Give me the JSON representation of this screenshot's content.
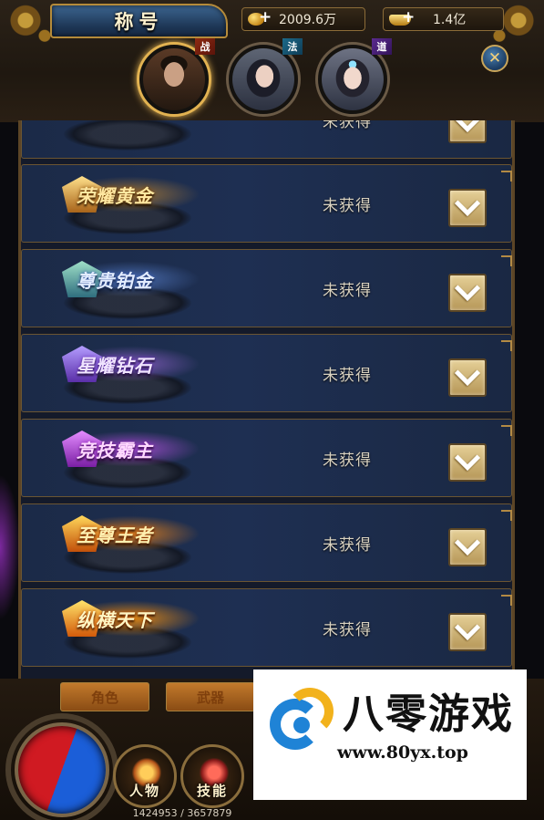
{
  "header": {
    "title": "称号",
    "gold": "2009.6万",
    "ingot": "1.4亿"
  },
  "classes": [
    {
      "badge": "战",
      "active": true
    },
    {
      "badge": "法",
      "active": false
    },
    {
      "badge": "道",
      "active": false
    }
  ],
  "titles": [
    {
      "name": "",
      "status": "未获得",
      "theme": "partial"
    },
    {
      "name": "荣耀黄金",
      "status": "未获得",
      "theme": "gold"
    },
    {
      "name": "尊贵铂金",
      "status": "未获得",
      "theme": "plat"
    },
    {
      "name": "星耀钻石",
      "status": "未获得",
      "theme": "dia"
    },
    {
      "name": "竞技霸主",
      "status": "未获得",
      "theme": "hegemon"
    },
    {
      "name": "至尊王者",
      "status": "未获得",
      "theme": "king"
    },
    {
      "name": "纵横天下",
      "status": "未获得",
      "theme": "world"
    }
  ],
  "bottom": {
    "sub_tabs": [
      "角色",
      "武器"
    ],
    "skills": [
      "人物",
      "技能"
    ],
    "exp_text": "1424953 / 3657879"
  },
  "watermark": {
    "brand": "八零游戏",
    "url": "www.80yx.top"
  },
  "icons": {
    "gold": "gold-coin-icon",
    "ingot": "gold-ingot-icon",
    "close": "close-icon",
    "expand": "chevron-down-icon"
  }
}
